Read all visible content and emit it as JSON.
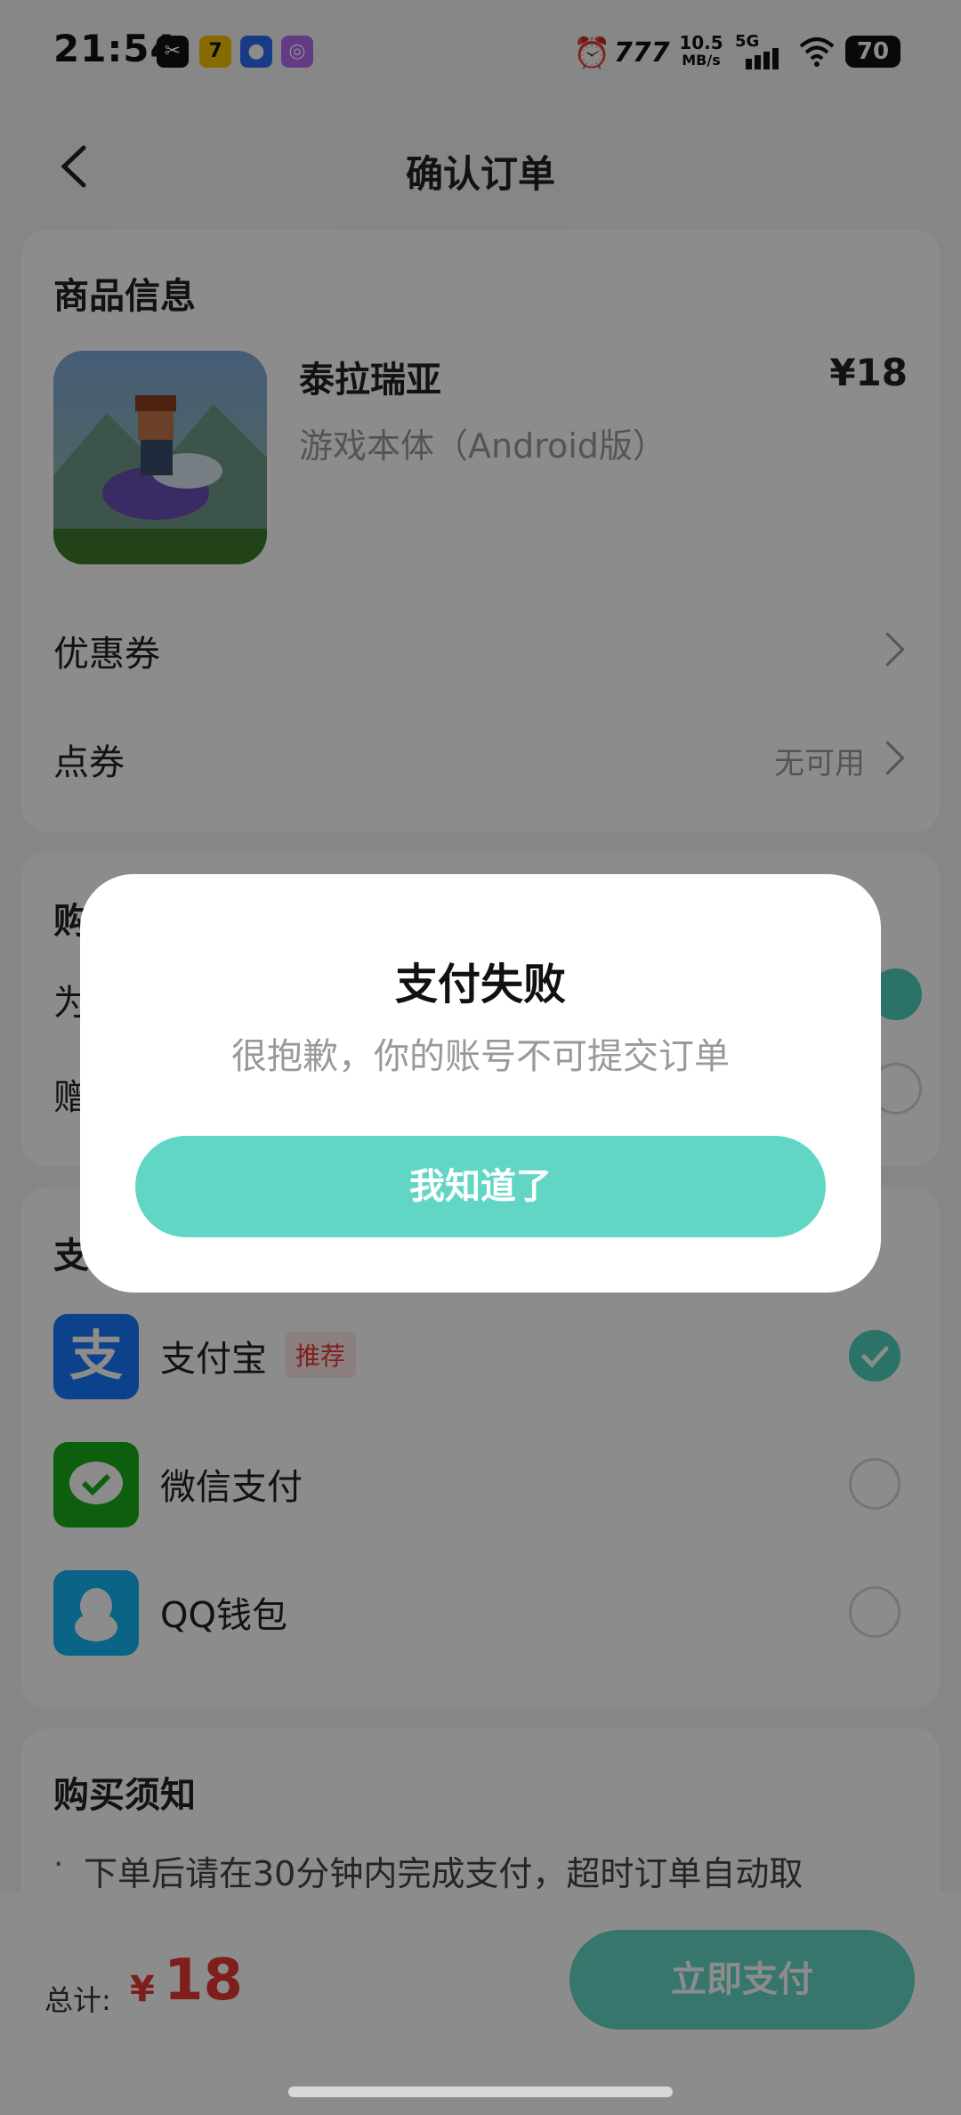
{
  "status_bar": {
    "time": "21:54",
    "speed": "10.5",
    "speed_unit": "MB/s",
    "network": "5G",
    "battery": "70"
  },
  "header": {
    "title": "确认订单"
  },
  "product": {
    "section_title": "商品信息",
    "name": "泰拉瑞亚",
    "variant": "游戏本体（Android版）",
    "price": "¥18"
  },
  "coupon": {
    "label": "优惠券"
  },
  "points": {
    "label": "点券",
    "value": "无可用"
  },
  "purchase_section": {
    "title_partial": "购",
    "row1_partial": "为",
    "row2_partial": "赠"
  },
  "payment_section": {
    "title_partial": "支",
    "options": [
      {
        "label": "支付宝",
        "badge": "推荐",
        "icon": "alipay-icon",
        "selected": true,
        "color": "#1677ff",
        "glyph": "支"
      },
      {
        "label": "微信支付",
        "icon": "wechat-pay-icon",
        "selected": false,
        "color": "#1aad19"
      },
      {
        "label": "QQ钱包",
        "icon": "qq-wallet-icon",
        "selected": false,
        "color": "#12b7f5"
      }
    ]
  },
  "notice": {
    "title": "购买须知",
    "bullet": "·",
    "text": "下单后请在30分钟内完成支付，超时订单自动取"
  },
  "footer": {
    "total_label": "总计:",
    "currency": "¥",
    "amount": "18",
    "pay_button": "立即支付",
    "accent": "#e53935"
  },
  "dialog": {
    "title": "支付失败",
    "message": "很抱歉，你的账号不可提交订单",
    "button": "我知道了",
    "accent": "#62d6c5"
  }
}
